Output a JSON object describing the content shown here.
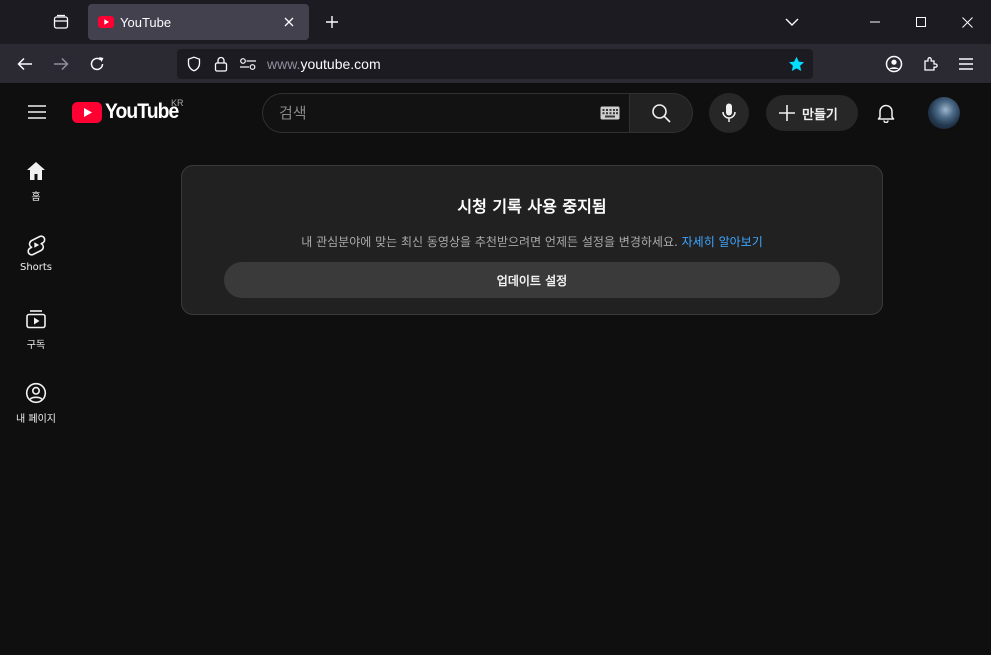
{
  "browser": {
    "tab": {
      "title": "YouTube"
    },
    "url": {
      "prefix": "www.",
      "domain": "youtube.com"
    },
    "colors": {
      "tabbar": "#1c1b22",
      "navbar": "#2b2a33",
      "active_tab": "#42414d",
      "star": "#00ddff"
    }
  },
  "youtube": {
    "logo_text": "YouTube",
    "region": "KR",
    "search": {
      "placeholder": "검색"
    },
    "create_label": "만들기",
    "sidebar": {
      "items": [
        {
          "label": "홈",
          "icon": "home-icon"
        },
        {
          "label": "Shorts",
          "icon": "shorts-icon"
        },
        {
          "label": "구독",
          "icon": "subscriptions-icon"
        },
        {
          "label": "내 페이지",
          "icon": "account-icon"
        }
      ]
    },
    "notice": {
      "title": "시청 기록 사용 중지됨",
      "description": "내 관심분야에 맞는 최신 동영상을 추천받으려면 언제든 설정을 변경하세요.",
      "link": "자세히 알아보기",
      "button": "업데이트 설정"
    },
    "colors": {
      "brand_red": "#ff0033",
      "link": "#3ea6ff",
      "background": "#0f0f0f"
    }
  }
}
